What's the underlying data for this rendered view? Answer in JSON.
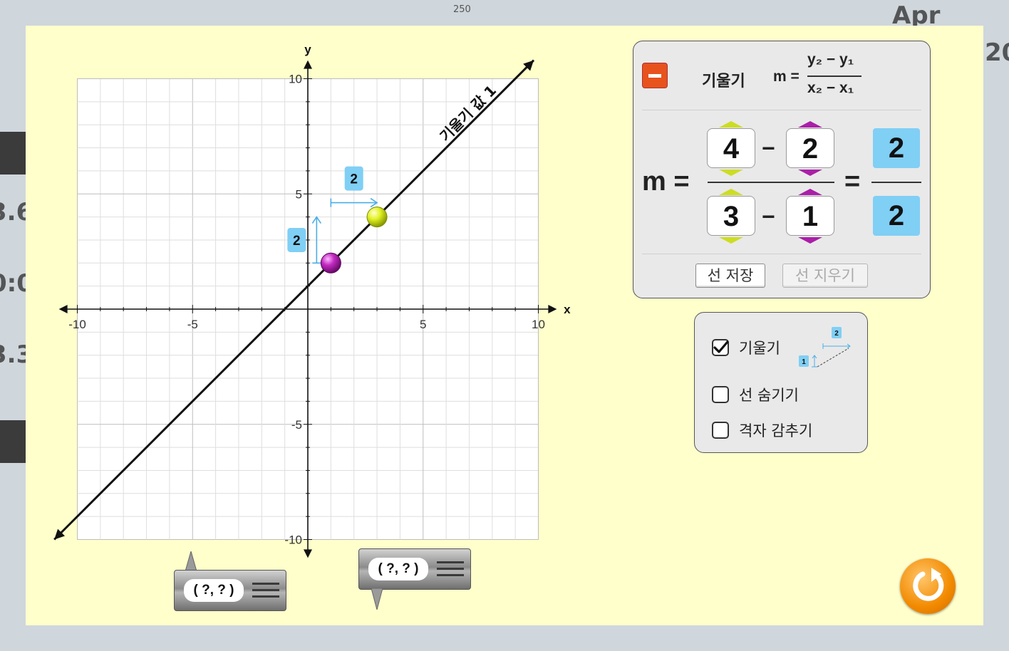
{
  "background": {
    "fragments": [
      "250",
      "Apr",
      "20",
      "3.6",
      "0:0",
      "3.3"
    ]
  },
  "graph": {
    "x_axis_label": "x",
    "y_axis_label": "y",
    "x_ticks": [
      "-10",
      "-5",
      "5",
      "10"
    ],
    "y_ticks": [
      "10",
      "5",
      "-5",
      "-10"
    ],
    "line_label": "기울기 값 1",
    "rise_label": "2",
    "run_label": "2",
    "point_magenta": {
      "x": 1,
      "y": 2,
      "color": "#b020b0"
    },
    "point_yellow": {
      "x": 3,
      "y": 4,
      "color": "#ddee22"
    },
    "line_color": "#111111",
    "rise_run_color": "#4aaee6"
  },
  "slope_panel": {
    "header_label": "기울기",
    "formula_prefix": "m =",
    "formula_numerator": "y₂ − y₁",
    "formula_denominator": "x₂ − x₁",
    "m_label": "m =",
    "numerator": {
      "y2": "4",
      "y1": "2",
      "op": "−"
    },
    "denominator": {
      "x2": "3",
      "x1": "1",
      "op": "−"
    },
    "equals": "=",
    "result": {
      "numerator": "2",
      "denominator": "2"
    },
    "save_line_label": "선 저장",
    "delete_line_label": "선 지우기"
  },
  "options_panel": {
    "slope_label": "기울기",
    "slope_checked": true,
    "hide_line_label": "선 숨기기",
    "hide_line_checked": false,
    "hide_grid_label": "격자 감추기",
    "hide_grid_checked": false,
    "mini_rise": "1",
    "mini_run": "2"
  },
  "coord_widgets": {
    "left_label": "( ?, ? )",
    "right_label": "( ?, ? )"
  },
  "icons": {
    "collapse": "minus-icon",
    "reset": "reset-icon",
    "check": "checkmark-icon"
  }
}
